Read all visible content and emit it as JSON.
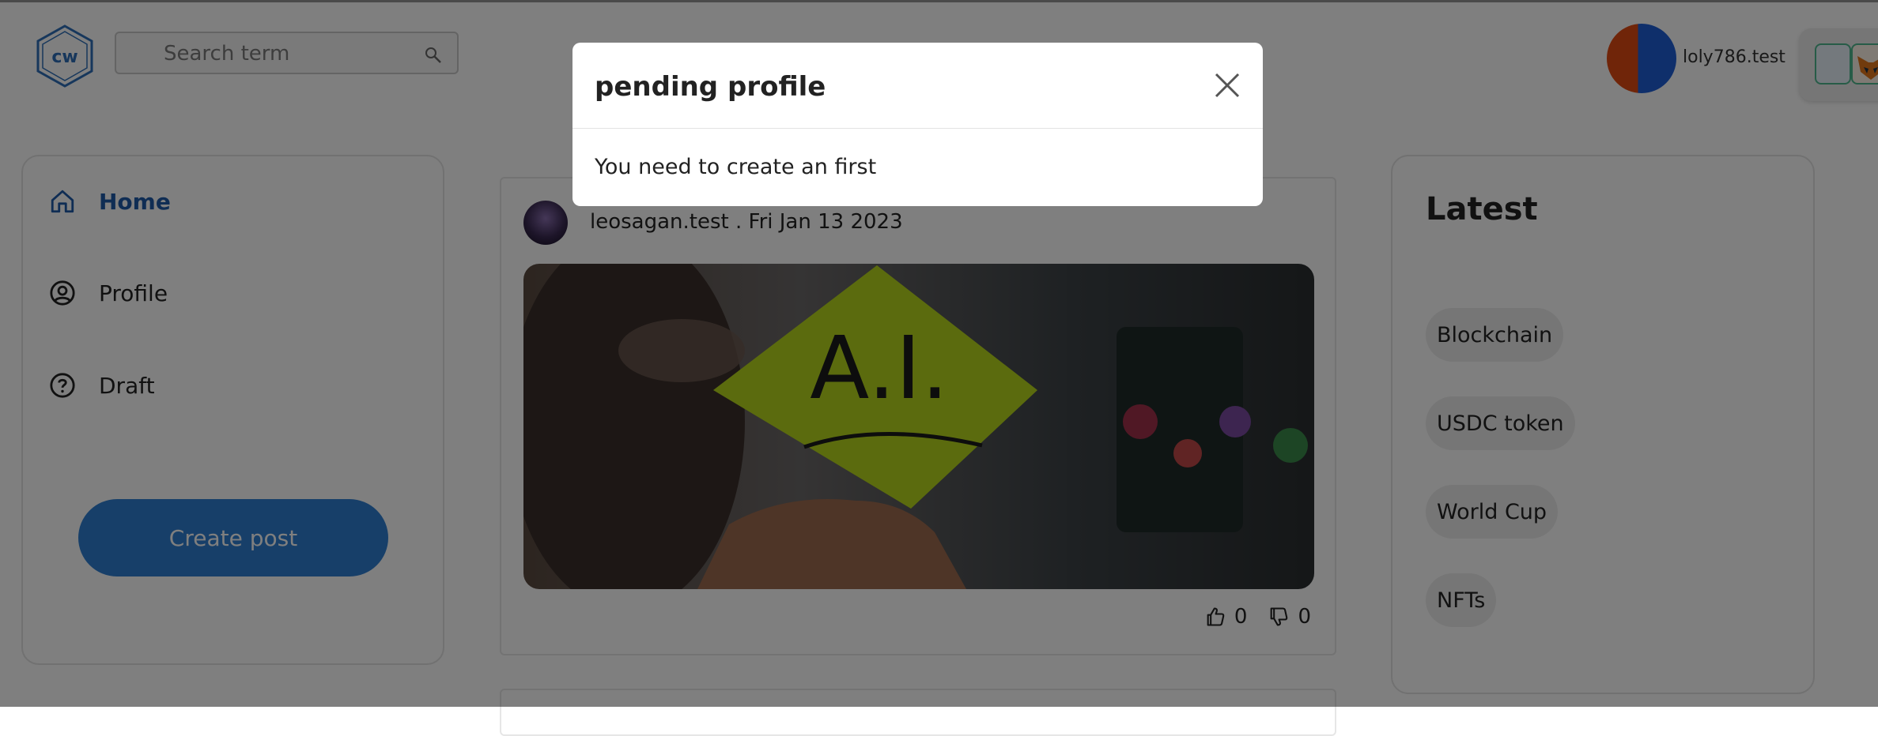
{
  "header": {
    "logo_text": "cw",
    "search_placeholder": "Search term",
    "user_name": "loly786.test"
  },
  "sidebar": {
    "items": [
      {
        "label": "Home",
        "icon": "home-icon",
        "active": true
      },
      {
        "label": "Profile",
        "icon": "user-circle-icon",
        "active": false
      },
      {
        "label": "Draft",
        "icon": "question-circle-icon",
        "active": false
      }
    ],
    "create_label": "Create post"
  },
  "post": {
    "meta": "leosagan.test . Fri Jan 13 2023",
    "image_text": "A.I.",
    "likes": "0",
    "dislikes": "0"
  },
  "latest": {
    "title": "Latest",
    "tags": [
      "Blockchain",
      "USDC token",
      "World Cup",
      "NFTs"
    ]
  },
  "modal": {
    "title": "pending profile",
    "body": "You need to create an first"
  },
  "colors": {
    "accent": "#2e7fd2",
    "active_nav": "#1f5aa8",
    "overlay": "rgba(0,0,0,0.5)"
  }
}
